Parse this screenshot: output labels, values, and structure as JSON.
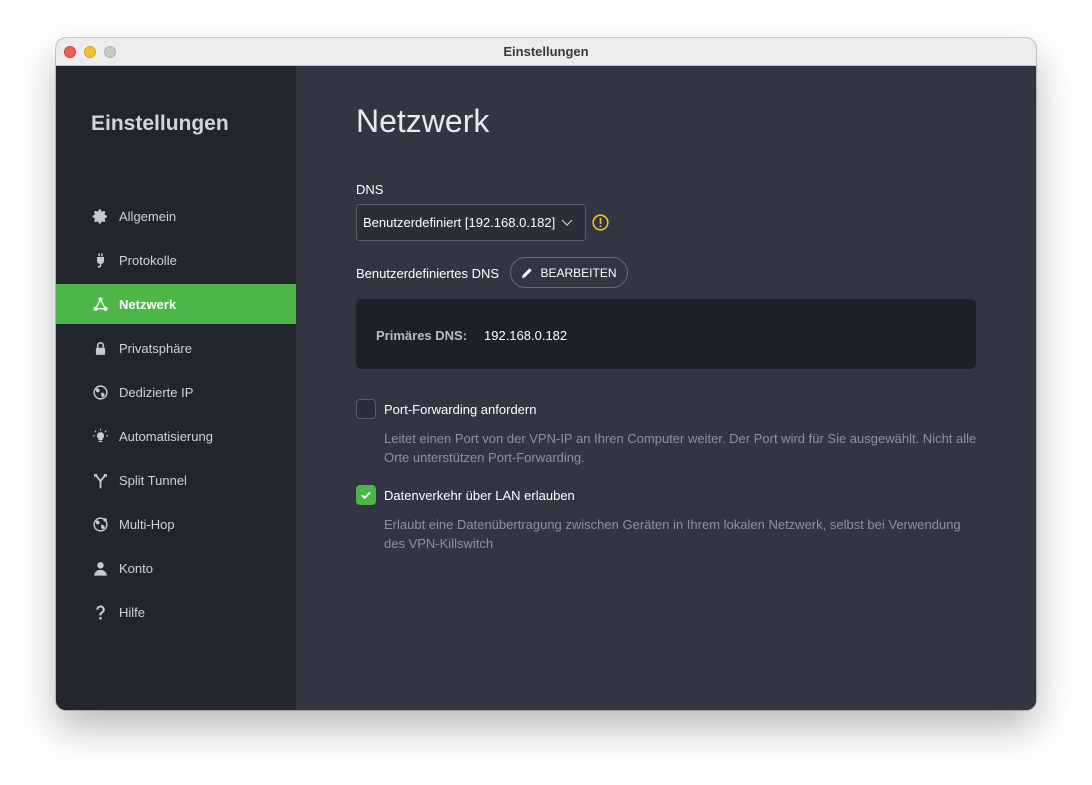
{
  "window": {
    "title": "Einstellungen"
  },
  "sidebar": {
    "title": "Einstellungen",
    "items": [
      {
        "label": "Allgemein",
        "icon": "gear-icon",
        "active": false
      },
      {
        "label": "Protokolle",
        "icon": "plug-icon",
        "active": false
      },
      {
        "label": "Netzwerk",
        "icon": "network-icon",
        "active": true
      },
      {
        "label": "Privatsphäre",
        "icon": "lock-icon",
        "active": false
      },
      {
        "label": "Dedizierte IP",
        "icon": "globe-icon",
        "active": false
      },
      {
        "label": "Automatisierung",
        "icon": "lightbulb-icon",
        "active": false
      },
      {
        "label": "Split Tunnel",
        "icon": "split-icon",
        "active": false
      },
      {
        "label": "Multi-Hop",
        "icon": "globe-network-icon",
        "active": false
      },
      {
        "label": "Konto",
        "icon": "user-icon",
        "active": false
      },
      {
        "label": "Hilfe",
        "icon": "help-icon",
        "active": false
      }
    ]
  },
  "main": {
    "title": "Netzwerk",
    "dns": {
      "label": "DNS",
      "selected": "Benutzerdefiniert [192.168.0.182]",
      "custom_label": "Benutzerdefiniertes DNS",
      "edit_button": "BEARBEITEN",
      "primary_key": "Primäres DNS:",
      "primary_value": "192.168.0.182"
    },
    "port_forwarding": {
      "label": "Port-Forwarding anfordern",
      "checked": false,
      "description": "Leitet einen Port von der VPN-IP an Ihren Computer weiter. Der Port wird für Sie ausgewählt. Nicht alle Orte unterstützen Port-Forwarding."
    },
    "lan": {
      "label": "Datenverkehr über LAN erlauben",
      "checked": true,
      "description": "Erlaubt eine Datenübertragung zwischen Geräten in Ihrem lokalen Netzwerk, selbst bei Verwendung des VPN-Killswitch"
    }
  },
  "colors": {
    "accent": "#4cb649",
    "warning": "#f2c21b",
    "sidebar_bg": "#23252e",
    "main_bg": "#333542"
  }
}
